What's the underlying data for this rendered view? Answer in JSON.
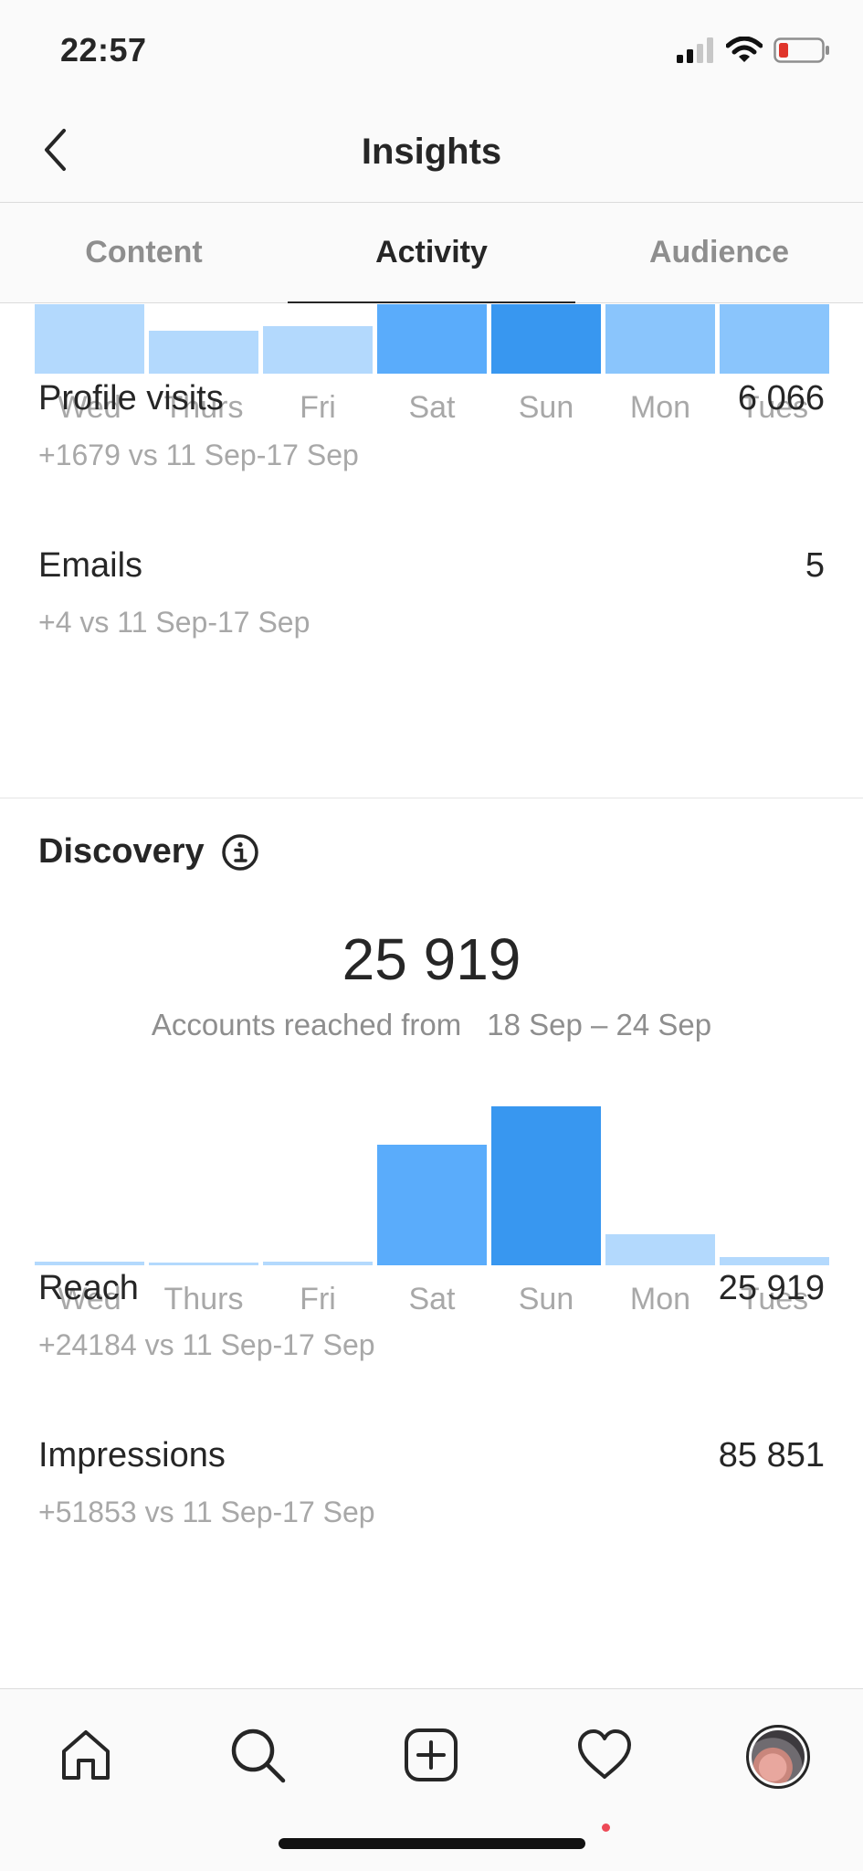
{
  "status_bar": {
    "time": "22:57",
    "icons": [
      "signal-icon",
      "wifi-icon",
      "battery-low-icon"
    ],
    "battery_color": "#e0352b"
  },
  "header": {
    "title": "Insights",
    "back_icon": "chevron-left-icon"
  },
  "tabs": [
    {
      "label": "Content",
      "active": false
    },
    {
      "label": "Activity",
      "active": true
    },
    {
      "label": "Audience",
      "active": false
    }
  ],
  "interactions_chart": {
    "days": [
      "Wed",
      "Thurs",
      "Fri",
      "Sat",
      "Sun",
      "Mon",
      "Tues"
    ],
    "colors": [
      "#b3d9fd",
      "#b3d9fd",
      "#b3d9fd",
      "#5aacfb",
      "#3897f0",
      "#8ac5fc",
      "#8ac5fc"
    ]
  },
  "interactions": [
    {
      "name": "Profile visits",
      "value": "6 066",
      "comparison": "+1679 vs 11 Sep-17 Sep"
    },
    {
      "name": "Emails",
      "value": "5",
      "comparison": "+4 vs 11 Sep-17 Sep"
    }
  ],
  "discovery": {
    "title": "Discovery",
    "info_icon": "info-icon",
    "accounts_reached": "25 919",
    "caption_prefix": "Accounts reached from",
    "caption_range": "18 Sep – 24 Sep"
  },
  "chart_data": {
    "type": "bar",
    "categories": [
      "Wed",
      "Thurs",
      "Fri",
      "Sat",
      "Sun",
      "Mon",
      "Tues"
    ],
    "values": [
      300,
      200,
      300,
      8800,
      11600,
      2300,
      600
    ],
    "colors": [
      "#b3d9fd",
      "#b3d9fd",
      "#b3d9fd",
      "#5aacfb",
      "#3897f0",
      "#b3d9fd",
      "#b3d9fd"
    ],
    "ylim": [
      0,
      11600
    ],
    "grid": false,
    "title": "",
    "xlabel": "",
    "ylabel": ""
  },
  "discovery_metrics": [
    {
      "name": "Reach",
      "value": "25 919",
      "comparison": "+24184 vs 11 Sep-17 Sep"
    },
    {
      "name": "Impressions",
      "value": "85 851",
      "comparison": "+51853 vs 11 Sep-17 Sep"
    }
  ],
  "bottom_nav": {
    "items": [
      "home-icon",
      "search-icon",
      "add-post-icon",
      "activity-heart-icon",
      "profile-avatar"
    ],
    "notification_color": "#ed4956"
  }
}
